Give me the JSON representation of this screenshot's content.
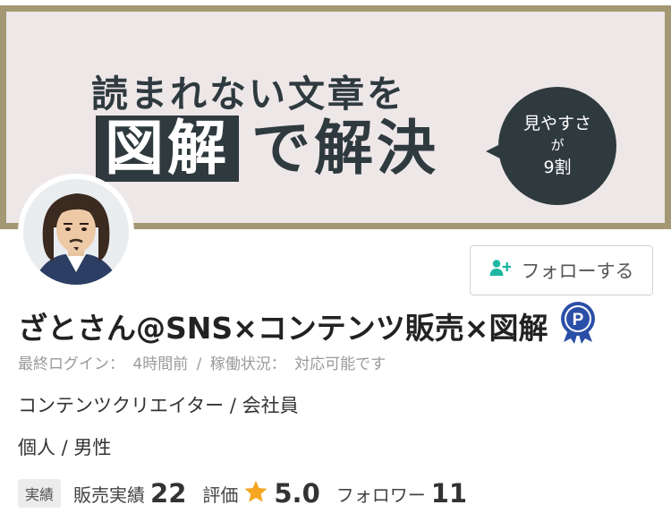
{
  "banner": {
    "line1": "読まれない文章を",
    "line2_highlight": "図解",
    "line2_rest": "で解決",
    "bubble_line1": "見やすさ",
    "bubble_line2": "が",
    "bubble_line3": "9割",
    "bg_color": "#ede7e8",
    "frame_color": "#a39873",
    "ink_color": "#2f3a3f"
  },
  "follow_button": {
    "label": "フォローする",
    "icon": "add-user-icon",
    "icon_color": "#1fb7a3"
  },
  "profile": {
    "name": "ざとさん@SNS×コンテンツ販売×図解",
    "badge_icon": "p-rank-badge-icon",
    "last_login_label": "最終ログイン：",
    "last_login_value": "4時間前",
    "sep": "/",
    "status_label": "稼働状況：",
    "status_value": "対応可能です",
    "occupation": "コンテンツクリエイター / 会社員",
    "demographics": "個人 / 男性"
  },
  "stats": {
    "tag": "実績",
    "sales_label": "販売実績",
    "sales_value": "22",
    "rating_label": "評価",
    "rating_value": "5.0",
    "followers_label": "フォロワー",
    "followers_value": "11",
    "star_color": "#f5a623"
  }
}
